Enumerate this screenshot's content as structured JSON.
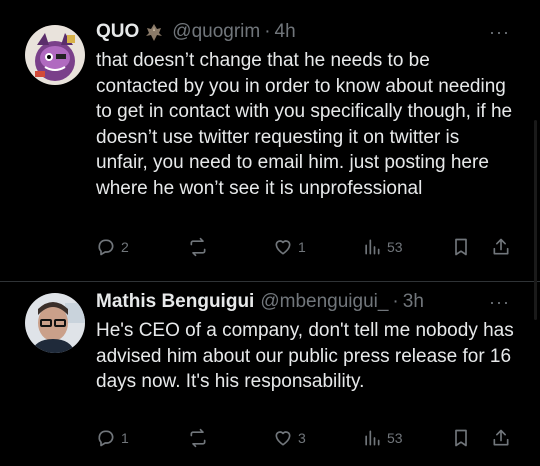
{
  "tweets": [
    {
      "name": "QUO",
      "handle": "@quogrim",
      "dot": "·",
      "time": "4h",
      "more": "···",
      "text": "that doesn’t change that he needs to be contacted by you in order to know about needing to get in contact with you specifically though, if he doesn’t use twitter requesting it on twitter is unfair, you need to email him. just posting here where he won’t see it is unprofessional",
      "replies": "2",
      "retweets": "",
      "likes": "1",
      "views": "53",
      "badge_icon": "bat-emoji-icon"
    },
    {
      "name": "Mathis Benguigui",
      "handle": "@mbenguigui_",
      "dot": "·",
      "time": "3h",
      "more": "···",
      "text": "He's CEO of a company, don't tell me nobody has advised him about our public press release for 16 days now. It's his responsability.",
      "replies": "1",
      "retweets": "",
      "likes": "3",
      "views": "53"
    }
  ],
  "colors": {
    "background": "#000000",
    "text": "#e7e9ea",
    "muted": "#71767b",
    "divider": "#2f3336"
  }
}
